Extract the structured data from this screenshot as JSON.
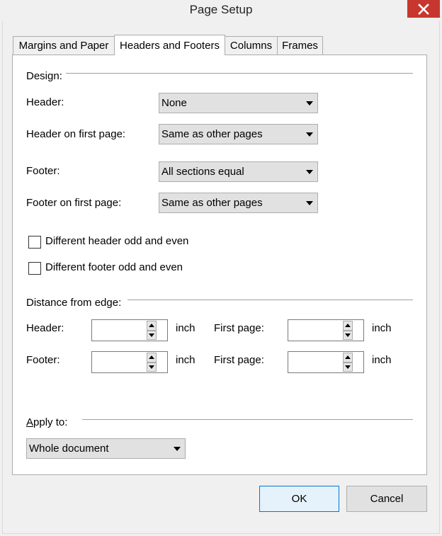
{
  "window": {
    "title": "Page Setup",
    "close_glyph": "✕"
  },
  "tabs": [
    {
      "label": "Margins and Paper",
      "active": false
    },
    {
      "label": "Headers and Footers",
      "active": true
    },
    {
      "label": "Columns",
      "active": false
    },
    {
      "label": "Frames",
      "active": false
    }
  ],
  "design": {
    "group_label": "Design:",
    "header_label": "Header:",
    "header_value": "None",
    "header_first_label": "Header on first page:",
    "header_first_value": "Same as other pages",
    "footer_label": "Footer:",
    "footer_value": "All sections equal",
    "footer_first_label": "Footer on first page:",
    "footer_first_value": "Same as other pages",
    "odd_even_header_label": "Different header odd and even",
    "odd_even_header_checked": false,
    "odd_even_footer_label": "Different footer odd and even",
    "odd_even_footer_checked": false
  },
  "distance": {
    "group_label": "Distance from edge:",
    "header_label": "Header:",
    "header_value": "",
    "header_unit": "inch",
    "header_first_label": "First page:",
    "header_first_value": "",
    "header_first_unit": "inch",
    "footer_label": "Footer:",
    "footer_value": "",
    "footer_unit": "inch",
    "footer_first_label": "First page:",
    "footer_first_value": "",
    "footer_first_unit": "inch"
  },
  "apply": {
    "label_accel": "A",
    "label_rest": "pply to:",
    "value": "Whole document"
  },
  "buttons": {
    "ok": "OK",
    "cancel": "Cancel"
  },
  "colors": {
    "close": "#c7372f",
    "default_button_border": "#0078d7"
  }
}
